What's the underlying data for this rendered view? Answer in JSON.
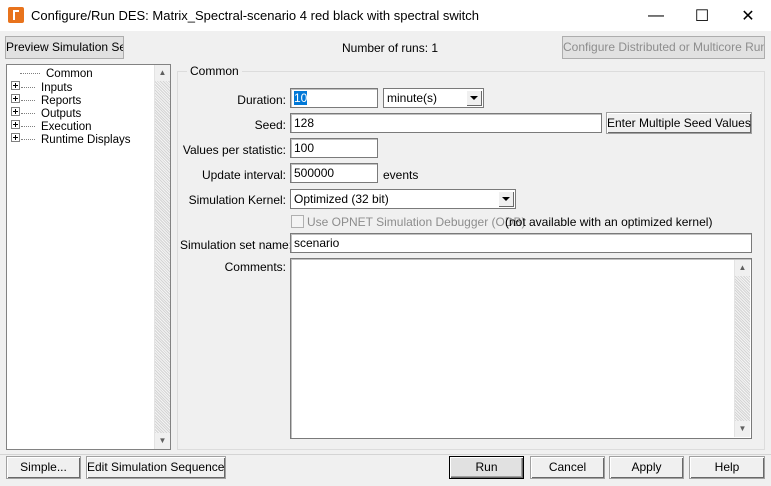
{
  "window": {
    "title": "Configure/Run DES: Matrix_Spectral-scenario 4 red black with spectral switch",
    "minimize": "—",
    "maximize": "☐",
    "close": "✕"
  },
  "toolbar": {
    "preview_label": "Preview Simulation Set",
    "runs_text": "Number of runs: 1",
    "configure_label": "Configure Distributed or Multicore Runs..."
  },
  "tree": {
    "items": [
      {
        "label": "Common",
        "expandable": false
      },
      {
        "label": "Inputs",
        "expandable": true
      },
      {
        "label": "Reports",
        "expandable": true
      },
      {
        "label": "Outputs",
        "expandable": true
      },
      {
        "label": "Execution",
        "expandable": true
      },
      {
        "label": "Runtime Displays",
        "expandable": true
      }
    ]
  },
  "common": {
    "group_title": "Common",
    "duration_label": "Duration:",
    "duration_value": "10",
    "duration_unit": "minute(s)",
    "seed_label": "Seed:",
    "seed_value": "128",
    "seed_button": "Enter Multiple Seed Values...",
    "values_label": "Values per statistic:",
    "values_value": "100",
    "update_label": "Update interval:",
    "update_value": "500000",
    "update_unit": "events",
    "kernel_label": "Simulation Kernel:",
    "kernel_value": "Optimized (32 bit)",
    "debugger_label": "Use OPNET Simulation Debugger (ODB)",
    "debugger_note": "(not available with an optimized kernel)",
    "set_name_label": "Simulation set name:",
    "set_name_value": "scenario",
    "comments_label": "Comments:",
    "comments_value": ""
  },
  "footer": {
    "simple": "Simple...",
    "edit_sequence": "Edit Simulation Sequence...",
    "run": "Run",
    "cancel": "Cancel",
    "apply": "Apply",
    "help": "Help"
  }
}
